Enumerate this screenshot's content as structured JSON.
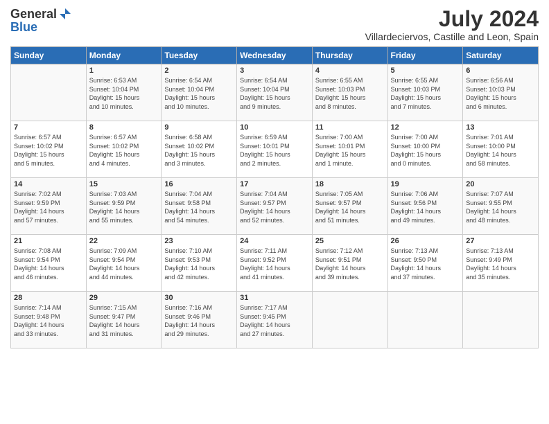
{
  "logo": {
    "general": "General",
    "blue": "Blue",
    "icon": "▶"
  },
  "title": "July 2024",
  "location": "Villardeciervos, Castille and Leon, Spain",
  "days_of_week": [
    "Sunday",
    "Monday",
    "Tuesday",
    "Wednesday",
    "Thursday",
    "Friday",
    "Saturday"
  ],
  "weeks": [
    [
      {
        "day": "",
        "info": ""
      },
      {
        "day": "1",
        "info": "Sunrise: 6:53 AM\nSunset: 10:04 PM\nDaylight: 15 hours\nand 10 minutes."
      },
      {
        "day": "2",
        "info": "Sunrise: 6:54 AM\nSunset: 10:04 PM\nDaylight: 15 hours\nand 10 minutes."
      },
      {
        "day": "3",
        "info": "Sunrise: 6:54 AM\nSunset: 10:04 PM\nDaylight: 15 hours\nand 9 minutes."
      },
      {
        "day": "4",
        "info": "Sunrise: 6:55 AM\nSunset: 10:03 PM\nDaylight: 15 hours\nand 8 minutes."
      },
      {
        "day": "5",
        "info": "Sunrise: 6:55 AM\nSunset: 10:03 PM\nDaylight: 15 hours\nand 7 minutes."
      },
      {
        "day": "6",
        "info": "Sunrise: 6:56 AM\nSunset: 10:03 PM\nDaylight: 15 hours\nand 6 minutes."
      }
    ],
    [
      {
        "day": "7",
        "info": "Sunrise: 6:57 AM\nSunset: 10:02 PM\nDaylight: 15 hours\nand 5 minutes."
      },
      {
        "day": "8",
        "info": "Sunrise: 6:57 AM\nSunset: 10:02 PM\nDaylight: 15 hours\nand 4 minutes."
      },
      {
        "day": "9",
        "info": "Sunrise: 6:58 AM\nSunset: 10:02 PM\nDaylight: 15 hours\nand 3 minutes."
      },
      {
        "day": "10",
        "info": "Sunrise: 6:59 AM\nSunset: 10:01 PM\nDaylight: 15 hours\nand 2 minutes."
      },
      {
        "day": "11",
        "info": "Sunrise: 7:00 AM\nSunset: 10:01 PM\nDaylight: 15 hours\nand 1 minute."
      },
      {
        "day": "12",
        "info": "Sunrise: 7:00 AM\nSunset: 10:00 PM\nDaylight: 15 hours\nand 0 minutes."
      },
      {
        "day": "13",
        "info": "Sunrise: 7:01 AM\nSunset: 10:00 PM\nDaylight: 14 hours\nand 58 minutes."
      }
    ],
    [
      {
        "day": "14",
        "info": "Sunrise: 7:02 AM\nSunset: 9:59 PM\nDaylight: 14 hours\nand 57 minutes."
      },
      {
        "day": "15",
        "info": "Sunrise: 7:03 AM\nSunset: 9:59 PM\nDaylight: 14 hours\nand 55 minutes."
      },
      {
        "day": "16",
        "info": "Sunrise: 7:04 AM\nSunset: 9:58 PM\nDaylight: 14 hours\nand 54 minutes."
      },
      {
        "day": "17",
        "info": "Sunrise: 7:04 AM\nSunset: 9:57 PM\nDaylight: 14 hours\nand 52 minutes."
      },
      {
        "day": "18",
        "info": "Sunrise: 7:05 AM\nSunset: 9:57 PM\nDaylight: 14 hours\nand 51 minutes."
      },
      {
        "day": "19",
        "info": "Sunrise: 7:06 AM\nSunset: 9:56 PM\nDaylight: 14 hours\nand 49 minutes."
      },
      {
        "day": "20",
        "info": "Sunrise: 7:07 AM\nSunset: 9:55 PM\nDaylight: 14 hours\nand 48 minutes."
      }
    ],
    [
      {
        "day": "21",
        "info": "Sunrise: 7:08 AM\nSunset: 9:54 PM\nDaylight: 14 hours\nand 46 minutes."
      },
      {
        "day": "22",
        "info": "Sunrise: 7:09 AM\nSunset: 9:54 PM\nDaylight: 14 hours\nand 44 minutes."
      },
      {
        "day": "23",
        "info": "Sunrise: 7:10 AM\nSunset: 9:53 PM\nDaylight: 14 hours\nand 42 minutes."
      },
      {
        "day": "24",
        "info": "Sunrise: 7:11 AM\nSunset: 9:52 PM\nDaylight: 14 hours\nand 41 minutes."
      },
      {
        "day": "25",
        "info": "Sunrise: 7:12 AM\nSunset: 9:51 PM\nDaylight: 14 hours\nand 39 minutes."
      },
      {
        "day": "26",
        "info": "Sunrise: 7:13 AM\nSunset: 9:50 PM\nDaylight: 14 hours\nand 37 minutes."
      },
      {
        "day": "27",
        "info": "Sunrise: 7:13 AM\nSunset: 9:49 PM\nDaylight: 14 hours\nand 35 minutes."
      }
    ],
    [
      {
        "day": "28",
        "info": "Sunrise: 7:14 AM\nSunset: 9:48 PM\nDaylight: 14 hours\nand 33 minutes."
      },
      {
        "day": "29",
        "info": "Sunrise: 7:15 AM\nSunset: 9:47 PM\nDaylight: 14 hours\nand 31 minutes."
      },
      {
        "day": "30",
        "info": "Sunrise: 7:16 AM\nSunset: 9:46 PM\nDaylight: 14 hours\nand 29 minutes."
      },
      {
        "day": "31",
        "info": "Sunrise: 7:17 AM\nSunset: 9:45 PM\nDaylight: 14 hours\nand 27 minutes."
      },
      {
        "day": "",
        "info": ""
      },
      {
        "day": "",
        "info": ""
      },
      {
        "day": "",
        "info": ""
      }
    ]
  ]
}
